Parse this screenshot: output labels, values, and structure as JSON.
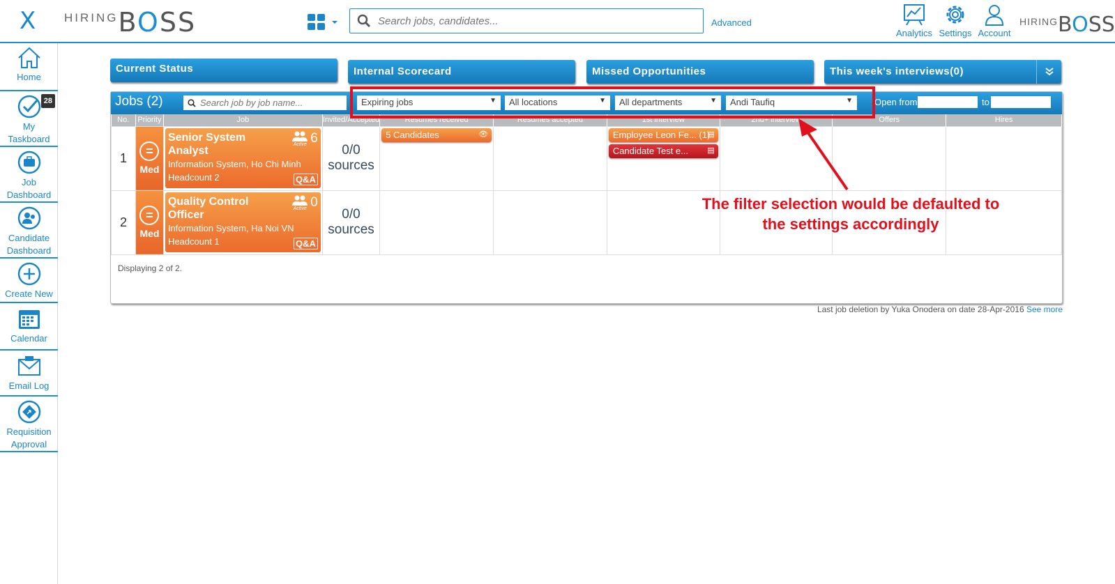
{
  "header": {
    "close_label": "X",
    "logo_left": {
      "hiring": "HIRING",
      "boss_b": "B",
      "boss_o": "O",
      "boss_rest": "SS"
    },
    "logo_right": {
      "hiring": "HIRING",
      "boss_b": "B",
      "boss_o": "O",
      "boss_rest": "SS"
    },
    "search_placeholder": "Search jobs, candidates...",
    "advanced_label": "Advanced",
    "analytics_label": "Analytics",
    "settings_label": "Settings",
    "account_label": "Account"
  },
  "sidebar": {
    "items": [
      {
        "label": "Home",
        "icon": "home-icon"
      },
      {
        "label": "My\nTaskboard",
        "icon": "checkmark-icon",
        "badge": "28"
      },
      {
        "label": "Job\nDashboard",
        "icon": "briefcase-icon"
      },
      {
        "label": "Candidate\nDashboard",
        "icon": "candidate-icon"
      },
      {
        "label": "Create New",
        "icon": "plus-icon"
      },
      {
        "label": "Calendar",
        "icon": "calendar-icon"
      },
      {
        "label": "Email Log",
        "icon": "email-icon"
      },
      {
        "label": "Requisition\nApproval",
        "icon": "approval-icon"
      }
    ]
  },
  "tabs": {
    "current_status": "Current Status",
    "internal_scorecard": "Internal Scorecard",
    "missed_opportunities": "Missed Opportunities",
    "weeks_interviews": "This week's interviews(0)"
  },
  "jobs": {
    "title": "Jobs (2)",
    "search_placeholder": "Search job by job name...",
    "filters": {
      "status": "Expiring jobs",
      "location": "All locations",
      "department": "All departments",
      "user": "Andi Taufiq"
    },
    "open_from_label": "Open from",
    "to_label": "to",
    "columns": [
      "No.",
      "Priority",
      "Job",
      "Invited/Accepted",
      "Resumes received",
      "Resumes accepted",
      "1st interview",
      "2nd+ interview",
      "Offers",
      "Hires"
    ],
    "rows": [
      {
        "no": "1",
        "priority": "Med",
        "title": "Senior System Analyst",
        "location": "Information System, Ho Chi Minh",
        "headcount": "Headcount 2",
        "active_count": "6",
        "active_label": "Active",
        "qa": "Q&A",
        "invited": "0/0",
        "sources": "sources",
        "resumes_received": "5 Candidates",
        "first_interview": [
          "Employee Leon Fe... (1)",
          "Candidate Test e..."
        ]
      },
      {
        "no": "2",
        "priority": "Med",
        "title": "Quality Control Officer",
        "location": "Information System, Ha Noi VN",
        "headcount": "Headcount 1",
        "active_count": "0",
        "active_label": "Active",
        "qa": "Q&A",
        "invited": "0/0",
        "sources": "sources"
      }
    ],
    "displaying": "Displaying 2 of 2."
  },
  "footer": {
    "last_deletion": "Last job deletion by Yuka Onodera on date 28-Apr-2016",
    "see_more": "See more"
  },
  "annotation": {
    "line1": "The filter selection would be defaulted to",
    "line2": "the settings accordingly"
  },
  "colors": {
    "brand_blue": "#1b8fd1",
    "orange": "#ec6a2c",
    "red": "#b8151c",
    "annotation_red": "#e0101c"
  }
}
